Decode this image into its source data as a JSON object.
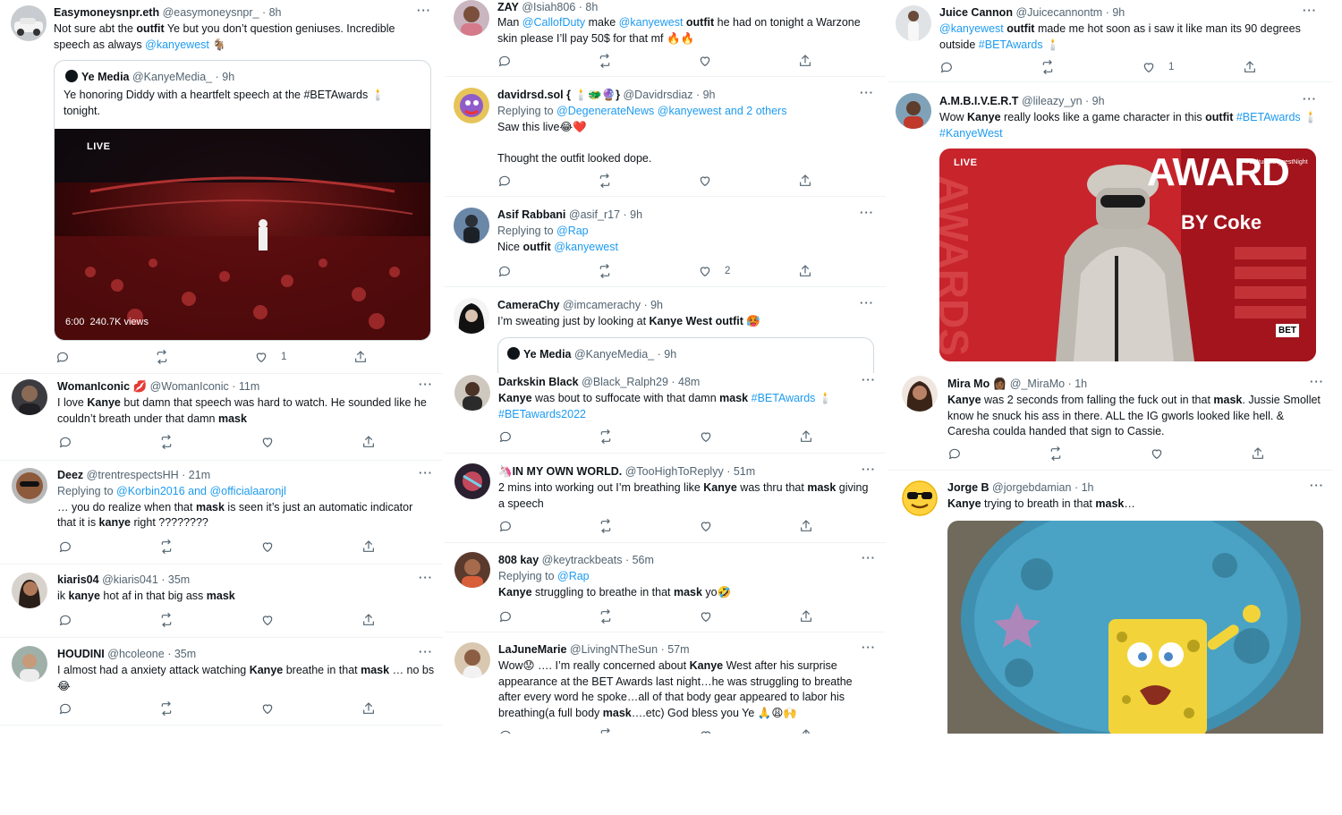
{
  "colors": {
    "link": "#1d9bf0",
    "muted": "#536471",
    "text": "#0f1419",
    "divider": "#eff3f4"
  },
  "columns": [
    {
      "tweets": [
        {
          "name": "Easymoneysnpr.eth",
          "handle": "@easymoneysnpr_",
          "time": "· 8h",
          "body_lines": [
            [
              {
                "t": "Not sure abt the "
              },
              {
                "b": "outfit"
              },
              {
                "t": " Ye but you don’t question geniuses. Incredible"
              }
            ],
            [
              {
                "t": "speech as always "
              },
              {
                "l": "@kanyewest"
              },
              {
                "t": " 🐐"
              }
            ]
          ],
          "quote": {
            "name": "Ye Media",
            "handle": "@KanyeMedia_",
            "time": "· 9h",
            "body_lines": [
              [
                {
                  "t": "Ye honoring Diddy with a heartfelt speech at the #BETAwards 🕯️"
                }
              ],
              [
                {
                  "t": "tonight."
                }
              ]
            ],
            "video": {
              "badge": "LIVE",
              "duration": "6:00",
              "views": "240.7K views"
            }
          },
          "likes": "1"
        },
        {
          "name": "WomanIconic",
          "name_emoji": "💋",
          "handle": "@WomanIconic",
          "time": "· 11m",
          "body_lines": [
            [
              {
                "t": "I love "
              },
              {
                "b": "Kanye"
              },
              {
                "t": " but damn that speech was hard to watch. He sounded like he"
              }
            ],
            [
              {
                "t": "couldn’t breath under that damn "
              },
              {
                "b": "mask"
              }
            ]
          ]
        },
        {
          "name": "Deez",
          "handle": "@trentrespectsHH",
          "time": "· 21m",
          "reply_to": {
            "prefix": "Replying to ",
            "target": "@Korbin2016 and @officialaaronjl"
          },
          "body_lines": [
            [
              {
                "t": "… you do realize when that "
              },
              {
                "b": "mask"
              },
              {
                "t": " is seen it’s just an automatic indicator"
              }
            ],
            [
              {
                "t": "that it is "
              },
              {
                "b": "kanye"
              },
              {
                "t": " right ????????"
              }
            ]
          ]
        },
        {
          "name": "kiaris04",
          "handle": "@kiaris041",
          "time": "· 35m",
          "body_lines": [
            [
              {
                "t": "ik "
              },
              {
                "b": "kanye"
              },
              {
                "t": " hot af in that big ass "
              },
              {
                "b": "mask"
              }
            ]
          ]
        },
        {
          "name": "HOUDINI",
          "handle": "@hcoleone",
          "time": "· 35m",
          "body_lines": [
            [
              {
                "t": "I almost had a anxiety attack watching "
              },
              {
                "b": "Kanye"
              },
              {
                "t": " breathe in that "
              },
              {
                "b": "mask"
              },
              {
                "t": " … no bs"
              }
            ],
            [
              {
                "t": "😂"
              }
            ]
          ]
        }
      ]
    },
    {
      "tweets": [
        {
          "name": "ZAY",
          "handle": "@Isiah806",
          "time": "· 8h",
          "body_lines": [
            [
              {
                "t": "Man "
              },
              {
                "l": "@CallofDuty"
              },
              {
                "t": " make "
              },
              {
                "l": "@kanyewest"
              },
              {
                "t": " "
              },
              {
                "b": "outfit"
              },
              {
                "t": " he had on tonight a Warzone"
              }
            ],
            [
              {
                "t": "skin please I’ll pay 50$ for that mf 🔥🔥"
              }
            ]
          ]
        },
        {
          "name": "davidrsd.sol { 🕯️🐲🔮}",
          "handle": "@Davidrsdiaz",
          "time": "· 9h",
          "reply_to": {
            "prefix": "Replying to ",
            "target": "@DegenerateNews @kanyewest and 2 others"
          },
          "body_lines": [
            [
              {
                "t": "Saw this live😂❤️"
              }
            ],
            [
              {
                "t": ""
              }
            ],
            [
              {
                "t": "Thought the outfit looked dope."
              }
            ]
          ]
        },
        {
          "name": "Asif Rabbani",
          "handle": "@asif_r17",
          "time": "· 9h",
          "reply_to": {
            "prefix": "Replying to ",
            "target": "@Rap"
          },
          "body_lines": [
            [
              {
                "t": "Nice "
              },
              {
                "b": "outfit"
              },
              {
                "t": " "
              },
              {
                "l": "@kanyewest"
              }
            ]
          ],
          "likes": "2"
        },
        {
          "name": "CameraChy",
          "handle": "@imcamerachy",
          "time": "· 9h",
          "body_lines": [
            [
              {
                "t": "I’m sweating just by looking at "
              },
              {
                "b": "Kanye West outfit"
              },
              {
                "t": " 🥵"
              }
            ]
          ],
          "quote": {
            "name": "Ye Media",
            "handle": "@KanyeMedia_",
            "time": "· 9h"
          }
        },
        {
          "name": "Darkskin Black",
          "handle": "@Black_Ralph29",
          "time": "· 48m",
          "body_lines": [
            [
              {
                "b": "Kanye"
              },
              {
                "t": " was bout to suffocate with that damn "
              },
              {
                "b": "mask"
              },
              {
                "t": " "
              },
              {
                "l": "#BETAwards"
              },
              {
                "t": " 🕯️"
              }
            ],
            [
              {
                "l": "#BETawards2022"
              }
            ]
          ]
        },
        {
          "name": "🦄IN MY OWN WORLD.",
          "handle": "@TooHighToReplyy",
          "time": "· 51m",
          "body_lines": [
            [
              {
                "t": "2 mins into working out I’m breathing like "
              },
              {
                "b": "Kanye"
              },
              {
                "t": " was thru that "
              },
              {
                "b": "mask"
              },
              {
                "t": " giving"
              }
            ],
            [
              {
                "t": "a speech"
              }
            ]
          ]
        },
        {
          "name": "808 kay",
          "handle": "@keytrackbeats",
          "time": "· 56m",
          "reply_to": {
            "prefix": "Replying to ",
            "target": "@Rap"
          },
          "body_lines": [
            [
              {
                "b": "Kanye"
              },
              {
                "t": " struggling to breathe in that "
              },
              {
                "b": "mask"
              },
              {
                "t": " yo🤣"
              }
            ]
          ]
        },
        {
          "name": "LaJuneMarie",
          "handle": "@LivingNTheSun",
          "time": "· 57m",
          "body_lines": [
            [
              {
                "t": "Wow😟 …. I’m really concerned about "
              },
              {
                "b": "Kanye"
              },
              {
                "t": " West after his surprise"
              }
            ],
            [
              {
                "t": "appearance at the BET Awards last night…he was struggling to breathe"
              }
            ],
            [
              {
                "t": "after every word he spoke…all of that body gear appeared to labor his"
              }
            ],
            [
              {
                "t": "breathing(a full body "
              },
              {
                "b": "mask"
              },
              {
                "t": "….etc) God bless you Ye 🙏😩🙌"
              }
            ]
          ]
        }
      ]
    },
    {
      "tweets": [
        {
          "name": "Juice Cannon",
          "handle": "@Juicecannontm",
          "time": "· 9h",
          "body_lines": [
            [
              {
                "l": "@kanyewest"
              },
              {
                "t": " "
              },
              {
                "b": "outfit"
              },
              {
                "t": " made me hot soon as i saw it like man its 90 degrees"
              }
            ],
            [
              {
                "t": "outside  "
              },
              {
                "l": "#BETAwards"
              },
              {
                "t": " 🕯️"
              }
            ]
          ],
          "likes": "1"
        },
        {
          "name": "A.M.B.I.V.E.R.T",
          "handle": "@lileazy_yn",
          "time": "· 9h",
          "body_lines": [
            [
              {
                "t": "Wow "
              },
              {
                "b": "Kanye"
              },
              {
                "t": " really looks like a game character in this "
              },
              {
                "b": "outfit"
              },
              {
                "t": " "
              },
              {
                "l": "#BETAwards"
              },
              {
                "t": " 🕯️"
              }
            ],
            [
              {
                "l": "#KanyeWest"
              }
            ]
          ],
          "image": {
            "badge": "LIVE",
            "sign_words": "AWARD",
            "sponsor": "BY Coke",
            "tagline": "#CulturesBiggestNight",
            "logo": "BET"
          }
        },
        {
          "name": "Mira Mo",
          "name_emoji": "👩🏾",
          "handle": "@_MiraMo",
          "time": "· 1h",
          "body_lines": [
            [
              {
                "b": "Kanye"
              },
              {
                "t": " was 2 seconds from falling the fuck out in that "
              },
              {
                "b": "mask"
              },
              {
                "t": ". Jussie Smollet"
              }
            ],
            [
              {
                "t": "know he snuck his ass in there. ALL the IG gworls looked like hell. &"
              }
            ],
            [
              {
                "t": "Caresha coulda handed that sign to Cassie."
              }
            ]
          ]
        },
        {
          "name": "Jorge B",
          "handle": "@jorgebdamian",
          "time": "· 1h",
          "body_lines": [
            [
              {
                "b": "Kanye"
              },
              {
                "t": " trying to breath in that "
              },
              {
                "b": "mask"
              },
              {
                "t": "…"
              }
            ]
          ]
        }
      ]
    }
  ]
}
